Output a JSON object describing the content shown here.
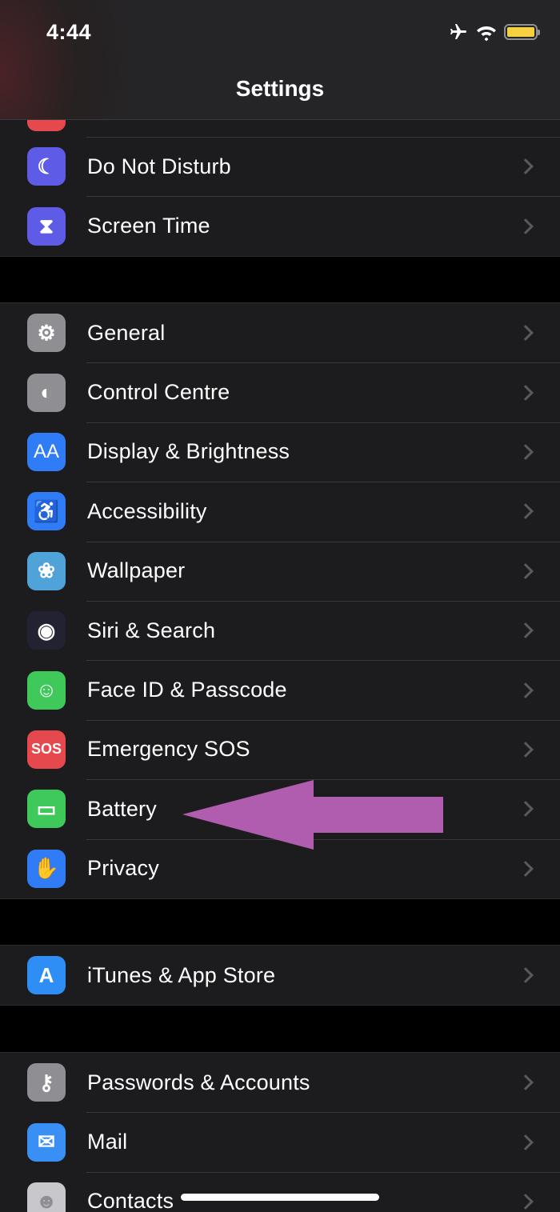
{
  "status_bar": {
    "time": "4:44",
    "icons": [
      "airplane-icon",
      "wifi-icon",
      "battery-icon"
    ],
    "battery_color": "#f5d142"
  },
  "header": {
    "title": "Settings"
  },
  "groups": [
    {
      "items": [
        {
          "label": "",
          "icon": "notifications-icon",
          "color": "#e5484d"
        },
        {
          "label": "Do Not Disturb",
          "icon": "moon-icon",
          "color": "#5e5ce6"
        },
        {
          "label": "Screen Time",
          "icon": "hourglass-icon",
          "color": "#5e5ce6"
        }
      ]
    },
    {
      "items": [
        {
          "label": "General",
          "icon": "gear-icon",
          "color": "#8e8e93"
        },
        {
          "label": "Control Centre",
          "icon": "toggles-icon",
          "color": "#8e8e93"
        },
        {
          "label": "Display & Brightness",
          "icon": "text-size-icon",
          "icon_text": "AA",
          "color": "#2f7cf6"
        },
        {
          "label": "Accessibility",
          "icon": "accessibility-icon",
          "color": "#2f7cf6"
        },
        {
          "label": "Wallpaper",
          "icon": "flower-icon",
          "color": "#4fa3d9"
        },
        {
          "label": "Siri & Search",
          "icon": "siri-icon",
          "color": "#222233"
        },
        {
          "label": "Face ID & Passcode",
          "icon": "face-id-icon",
          "color": "#3ec95a"
        },
        {
          "label": "Emergency SOS",
          "icon": "sos-icon",
          "icon_text": "SOS",
          "color": "#e5484d"
        },
        {
          "label": "Battery",
          "icon": "battery-setting-icon",
          "color": "#3ec95a"
        },
        {
          "label": "Privacy",
          "icon": "hand-icon",
          "color": "#2f7cf6"
        }
      ]
    },
    {
      "items": [
        {
          "label": "iTunes & App Store",
          "icon": "app-store-icon",
          "color": "#2f8ef6"
        }
      ]
    },
    {
      "items": [
        {
          "label": "Passwords & Accounts",
          "icon": "key-icon",
          "color": "#8e8e93"
        },
        {
          "label": "Mail",
          "icon": "envelope-icon",
          "color": "#3a8ff5"
        },
        {
          "label": "Contacts",
          "icon": "contacts-icon",
          "color": "#c8c8cc"
        }
      ]
    }
  ],
  "annotation": {
    "arrow_color": "#b05db0",
    "points_to": "Battery"
  }
}
